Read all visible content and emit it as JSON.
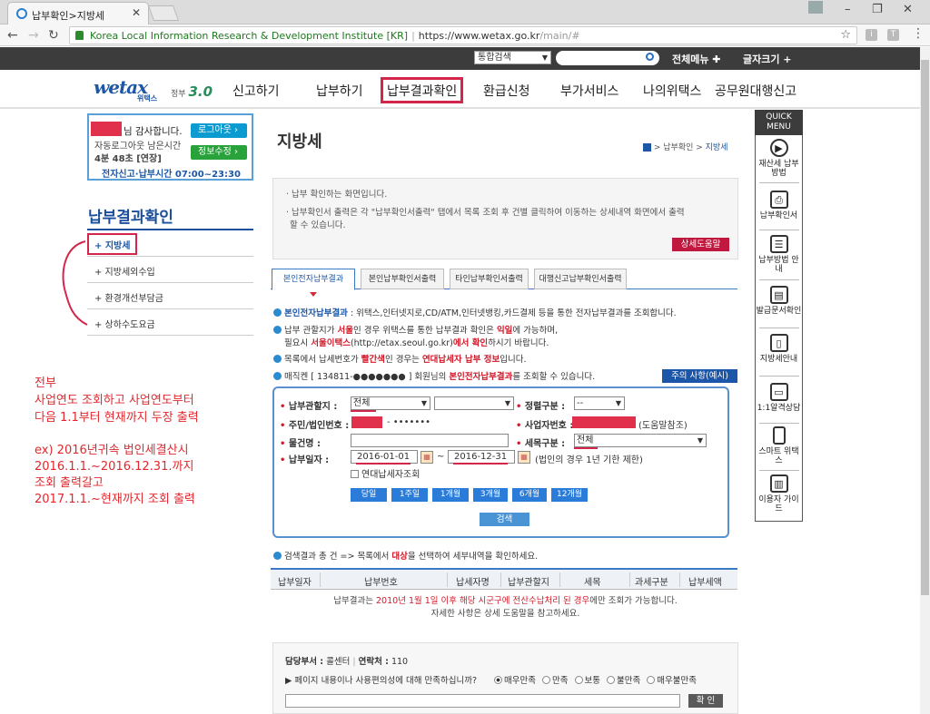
{
  "browser": {
    "tab_title": "납부확인>지방세",
    "site_identity": "Korea Local Information Research & Development Institute [KR]",
    "url": "https://www.wetax.go.kr",
    "url_path": "/main/#"
  },
  "topbar": {
    "search_scope": "통합검색",
    "all_menu": "전체메뉴 ✚",
    "font_size": "글자크기 +"
  },
  "logo": {
    "text": "wetax",
    "sub": "위택스",
    "gov": "정부",
    "gov_ver": "3.0"
  },
  "gnb": [
    "신고하기",
    "납부하기",
    "납부결과확인",
    "환급신청",
    "부가서비스",
    "나의위택스",
    "공무원대행신고"
  ],
  "login": {
    "greeting": "님 감사합니다.",
    "auto_logout": "자동로그아웃 남은시간",
    "time": "4분 48초 [연장]",
    "hours": "전자신고·납부시간 07:00~23:30",
    "logout": "로그아웃 ›",
    "edit_info": "정보수정 ›"
  },
  "lnb": {
    "title": "납부결과확인",
    "items": [
      "+ 지방세",
      "+ 지방세외수입",
      "+ 환경개선부담금",
      "+ 상하수도요금"
    ]
  },
  "annotation": [
    "전부",
    "사업연도 조회하고 사업연도부터",
    "다음 1.1부터 현재까지 두장 출력",
    "",
    "ex) 2016년귀속 법인세결산시",
    "2016.1.1.~2016.12.31.까지",
    "조회 출력갈고",
    "2017.1.1.~현재까지 조회 출력"
  ],
  "content": {
    "title": "지방세",
    "breadcrumb": [
      "납부확인",
      "지방세"
    ],
    "info": [
      "· 납부 확인하는 화면입니다.",
      "· 납부확인서 출력은 각 \"납부확인서출력\" 탭에서 목록 조회 후 건별 클릭하여 이동하는 상세내역 화면에서 출력",
      "할 수 있습니다."
    ],
    "help_button": "상세도움말",
    "tabs": [
      "본인전자납부결과",
      "본인납부확인서출력",
      "타인납부확인서출력",
      "대행신고납부확인서출력"
    ],
    "guide": [
      {
        "b": "본인전자납부결과",
        "t": " : 위택스,인터넷지로,CD/ATM,인터넷뱅킹,카드결제 등을 통한 전자납부결과를 조회합니다."
      },
      {
        "p1": "납부 관할지가 ",
        "r1": "서울",
        "p2": "인 경우 위택스를 통한 납부결과 확인은 ",
        "r2": "익일",
        "p3": "에 가능하며,"
      },
      {
        "p1": "필요시 ",
        "r1": "서울이택스",
        "p2": "(http://etax.seoul.go.kr)",
        "r2": "에서 확인",
        "p3": "하시기 바랍니다."
      },
      {
        "p1": "목록에서 납세번호가 ",
        "r1": "빨간색",
        "p2": "인 경우는 ",
        "r2": "연대납세자 납부 정보",
        "p3": "입니다."
      },
      {
        "p1": "매직켄 [ 134811-●●●●●●● ] 회원님의 ",
        "b": "본인전자납부결과",
        "p3": "를 조회할 수 있습니다."
      }
    ],
    "notice_button": "주의 사항(예시)",
    "form": {
      "jurisdiction_label": "납부관할지 :",
      "jurisdiction_value": "전체",
      "jurisdiction2_value": "",
      "fix_type_label": "정렬구분 :",
      "fix_type_value": "--",
      "idnum_label": "주민/법인번호 :",
      "idnum_suffix": "- •••••••",
      "biznum_label": "사업자번호 :",
      "biznum_note": "(도움말참조)",
      "item_label": "물건명 :",
      "tax_type_label": "세목구분 :",
      "tax_type_value": "전체",
      "date_label": "납부일자 :",
      "date_from": "2016-01-01",
      "date_tilde": "~",
      "date_to": "2016-12-31",
      "date_note": "(법인의 경우 1년 기한 제한)",
      "joint_label": "연대납세자조회",
      "periods": [
        "당일",
        "1주일",
        "1개월",
        "3개월",
        "6개월",
        "12개월"
      ],
      "search": "검색"
    },
    "result_intro_a": "검색결과 총 건 => 목록에서 ",
    "result_intro_red": "대상",
    "result_intro_b": "을 선택하여 세부내역을 확인하세요.",
    "columns": [
      "납부일자",
      "납부번호",
      "납세자명",
      "납부관할지",
      "세목",
      "과세구분",
      "납부세액"
    ],
    "msg1_a": "납부결과는 ",
    "msg1_red": "2010년 1월 1일 이후 해당 시군구에 전산수납처리 된 경우",
    "msg1_b": "에만 조회가 가능합니다.",
    "msg2": "자세한 사항은 상세 도움말을 참고하세요.",
    "footer": {
      "dept_label": "담당부서 :",
      "dept": "콜센터",
      "contact_label": "연락처 :",
      "contact": "110",
      "question": "▶ 페이지 내용이나 사용편의성에 대해 만족하십니까?",
      "ratings": [
        "매우만족",
        "만족",
        "보통",
        "불만족",
        "매우불만족"
      ],
      "confirm": "확 인"
    }
  },
  "quick_menu": {
    "title": "QUICK MENU",
    "items": [
      "재산세 납부방법",
      "납부확인서",
      "납부방법 안내",
      "발급문서확인",
      "지방세안내",
      "1:1알격상담",
      "스마트 위택스",
      "이용자 가이드"
    ]
  }
}
